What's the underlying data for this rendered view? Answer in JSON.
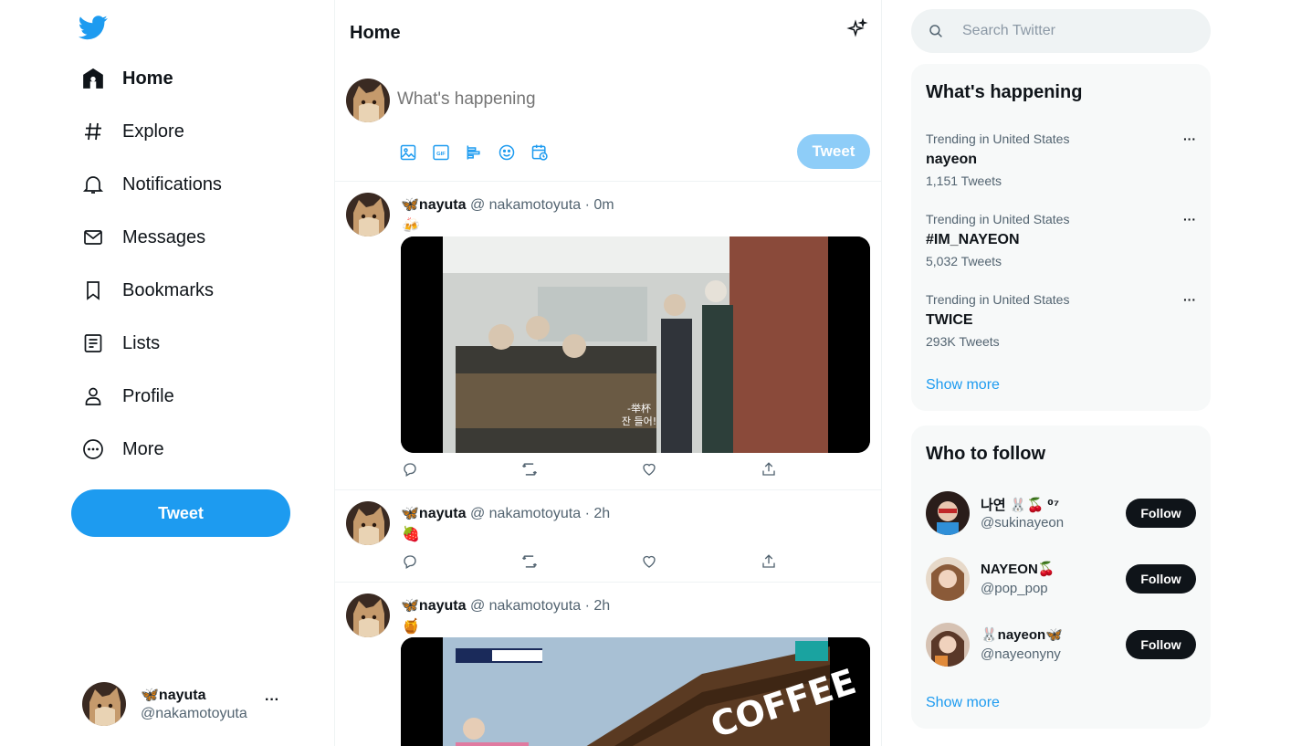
{
  "colors": {
    "accent": "#1d9bf0",
    "accent_disabled": "#8ecdf8",
    "text": "#0f1419",
    "muted": "#536471"
  },
  "nav": {
    "items": [
      {
        "label": "Home",
        "icon": "home-icon",
        "active": true
      },
      {
        "label": "Explore",
        "icon": "hashtag-icon"
      },
      {
        "label": "Notifications",
        "icon": "bell-icon"
      },
      {
        "label": "Messages",
        "icon": "envelope-icon"
      },
      {
        "label": "Bookmarks",
        "icon": "bookmark-icon"
      },
      {
        "label": "Lists",
        "icon": "list-icon"
      },
      {
        "label": "Profile",
        "icon": "person-icon"
      },
      {
        "label": "More",
        "icon": "more-circle-icon"
      }
    ],
    "tweet_button": "Tweet"
  },
  "account": {
    "display_name": "🦋nayuta",
    "handle": "@nakamotoyuta",
    "menu": "···"
  },
  "main": {
    "title": "Home",
    "composer": {
      "placeholder": "What's happening",
      "button": "Tweet"
    },
    "tweets": [
      {
        "display_name": "🦋nayuta",
        "meta": "@ nakamotoyuta · 0m",
        "text": "🍻",
        "media": "video-thumbnail",
        "media_caption": "-举杯\n잔 들어!"
      },
      {
        "display_name": "🦋nayuta",
        "meta": "@ nakamotoyuta · 2h",
        "text": "🍓"
      },
      {
        "display_name": "🦋nayuta",
        "meta": "@ nakamotoyuta · 2h",
        "text": "🍯",
        "media": "video-thumbnail",
        "media_caption": "COFFEE"
      }
    ]
  },
  "search": {
    "placeholder": "Search Twitter"
  },
  "trends": {
    "title": "What's happening",
    "items": [
      {
        "context": "Trending in United States",
        "name": "nayeon",
        "count": "1,151 Tweets"
      },
      {
        "context": "Trending in United States",
        "name": "#IM_NAYEON",
        "count": "5,032 Tweets"
      },
      {
        "context": "Trending in United States",
        "name": "TWICE",
        "count": "293K Tweets"
      }
    ],
    "more_label": "···",
    "show_more": "Show more"
  },
  "who_to_follow": {
    "title": "Who to follow",
    "items": [
      {
        "name": "나연 🐰🍒 ⁰⁷",
        "handle": "@sukinayeon",
        "button": "Follow"
      },
      {
        "name": "NAYEON🍒",
        "handle": "@pop_pop",
        "button": "Follow"
      },
      {
        "name": "🐰nayeon🦋",
        "handle": "@nayeonyny",
        "button": "Follow"
      }
    ],
    "show_more": "Show more"
  }
}
